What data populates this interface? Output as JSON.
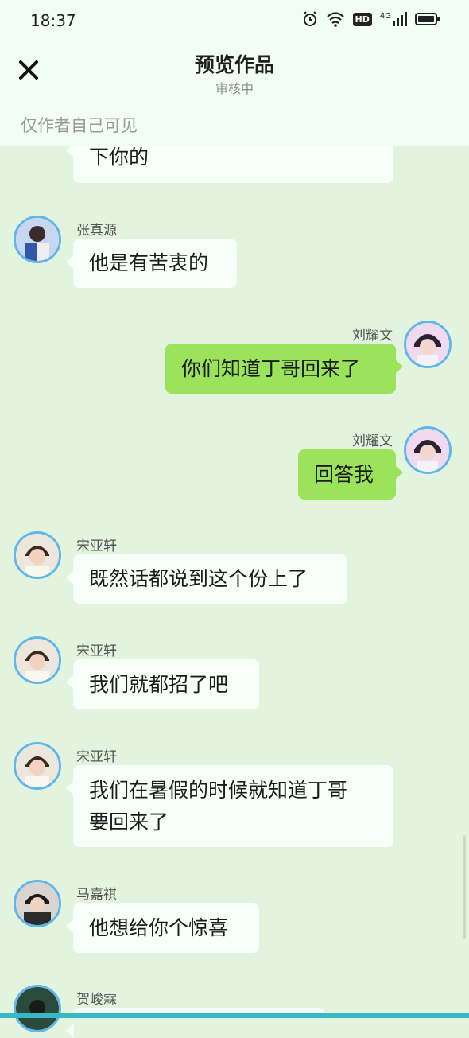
{
  "status_bar": {
    "time": "18:37",
    "network": "4G",
    "hd": "HD"
  },
  "header": {
    "title": "预览作品",
    "subtitle": "审核中",
    "visibility": "仅作者自己可见"
  },
  "messages": [
    {
      "side": "left",
      "text": "下你的"
    },
    {
      "side": "left",
      "name": "张真源",
      "text": "他是有苦衷的"
    },
    {
      "side": "right",
      "name": "刘耀文",
      "text": "你们知道丁哥回来了"
    },
    {
      "side": "right",
      "name": "刘耀文",
      "text": "回答我"
    },
    {
      "side": "left",
      "name": "宋亚轩",
      "text": "既然话都说到这个份上了"
    },
    {
      "side": "left",
      "name": "宋亚轩",
      "text": "我们就都招了吧"
    },
    {
      "side": "left",
      "name": "宋亚轩",
      "text": "我们在暑假的时候就知道丁哥\n要回来了"
    },
    {
      "side": "left",
      "name": "马嘉祺",
      "text": "他想给你个惊喜"
    },
    {
      "side": "left",
      "name": "贺峻霖",
      "text": ""
    }
  ],
  "colors": {
    "background": "#e3f4de",
    "header": "#f2fdf6",
    "bubble_left": "#f7fff9",
    "bubble_right": "#9be35a",
    "avatar_ring": "#5fb7ec"
  }
}
